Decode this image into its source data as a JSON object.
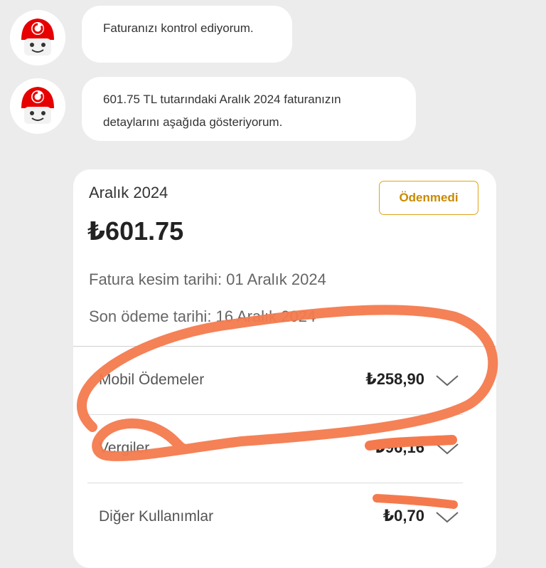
{
  "chat": {
    "messages": [
      {
        "text": "Faturanızı kontrol ediyorum."
      },
      {
        "line1": "601.75 TL tutarındaki Aralık 2024 faturanızın",
        "line2": "detaylarını aşağıda gösteriyorum."
      }
    ]
  },
  "bill": {
    "period": "Aralık 2024",
    "status": "Ödenmedi",
    "amount": "₺601.75",
    "issue_date": "Fatura kesim tarihi: 01 Aralık 2024",
    "due_date": "Son ödeme tarihi: 16 Aralık 2024",
    "items": [
      {
        "label": "Mobil Ödemeler",
        "value": "₺258,90"
      },
      {
        "label": "Vergiler",
        "value": "₺96,16"
      },
      {
        "label": "Diğer Kullanımlar",
        "value": "₺0,70"
      }
    ]
  },
  "colors": {
    "brand_red": "#e60000",
    "status_border": "#e0a418",
    "annotation": "#f47a4e"
  },
  "icons": {
    "avatar": "vodafone-robot-avatar-icon",
    "chevron": "chevron-down-icon"
  }
}
